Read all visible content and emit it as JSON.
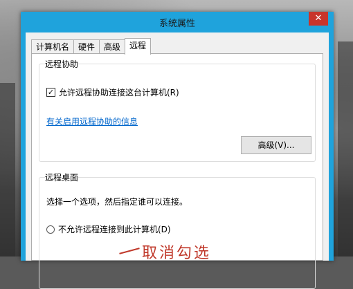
{
  "window": {
    "title": "系统属性",
    "close_glyph": "✕"
  },
  "tabs": [
    "计算机名",
    "硬件",
    "高级",
    "远程"
  ],
  "remote_assistance": {
    "group_title": "远程协助",
    "allow_label": "允许远程协助连接这台计算机(R)",
    "allow_checked": true,
    "info_link": "有关启用远程协助的信息",
    "advanced_button": "高级(V)..."
  },
  "remote_desktop": {
    "group_title": "远程桌面",
    "instruction": "选择一个选项，然后指定谁可以连接。",
    "deny_label": "不允许远程连接到此计算机(D)"
  },
  "annotation": "取消勾选"
}
